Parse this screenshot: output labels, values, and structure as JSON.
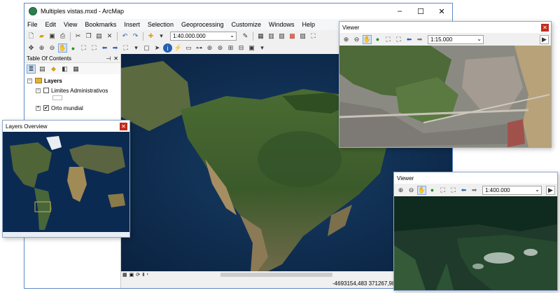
{
  "arcmap": {
    "title": "Multiples vistas.mxd - ArcMap",
    "menu": [
      "File",
      "Edit",
      "View",
      "Bookmarks",
      "Insert",
      "Selection",
      "Geoprocessing",
      "Customize",
      "Windows",
      "Help"
    ],
    "scale": "1:40.000.000",
    "coords": "-4693154,483  371267,987 M"
  },
  "toc": {
    "title": "Table Of Contents",
    "root": "Layers",
    "layers": [
      {
        "name": "Limites Administrativos",
        "checked": false
      },
      {
        "name": "Orto mundial",
        "checked": true
      }
    ]
  },
  "overview": {
    "title": "Layers Overview"
  },
  "viewer1": {
    "title": "Viewer",
    "scale": "1:15.000"
  },
  "viewer2": {
    "title": "Viewer",
    "scale": "1:400.000"
  },
  "colors": {
    "ocean": "#0d2b4f",
    "land": "#3d5a2c",
    "accent": "#c42b1c",
    "border": "#5d8ac8"
  },
  "icons": [
    "app-icon",
    "new-icon",
    "open-icon",
    "save-icon",
    "print-icon",
    "cut-icon",
    "copy-icon",
    "paste-icon",
    "delete-icon",
    "undo-icon",
    "redo-icon",
    "add-data-icon",
    "zoom-in-icon",
    "zoom-out-icon",
    "pan-icon",
    "globe-icon",
    "full-extent-icon",
    "back-icon",
    "forward-icon",
    "select-icon",
    "info-icon",
    "find-icon",
    "close-icon"
  ]
}
